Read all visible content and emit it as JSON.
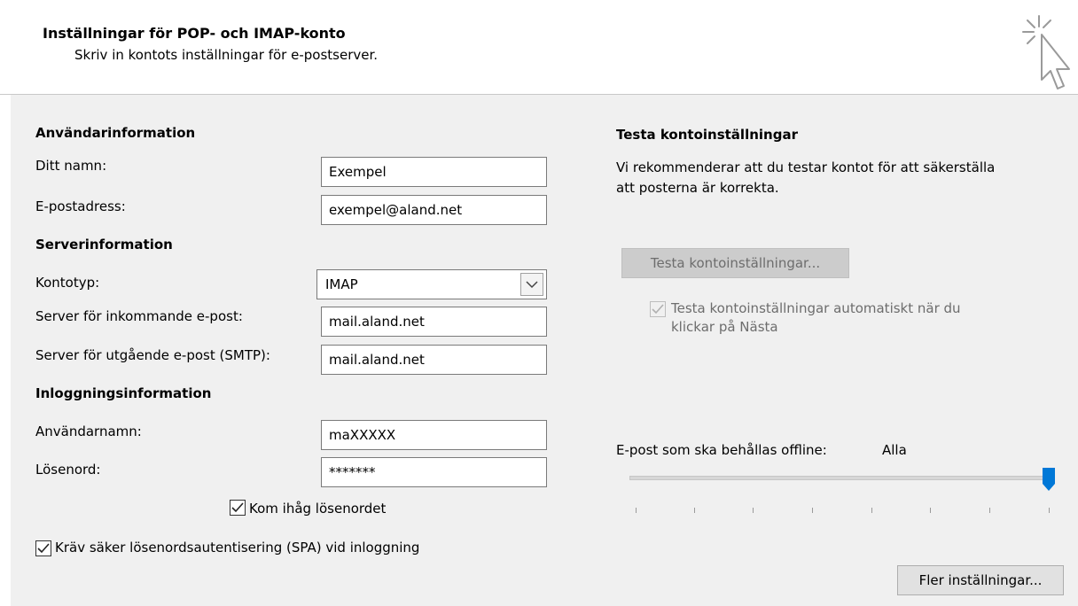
{
  "header": {
    "title": "Inställningar för POP- och IMAP-konto",
    "subtitle": "Skriv in kontots inställningar för e-postserver."
  },
  "user_info": {
    "heading": "Användarinformation",
    "name_label": "Ditt namn:",
    "name_value": "Exempel",
    "email_label": "E-postadress:",
    "email_value": "exempel@aland.net"
  },
  "server_info": {
    "heading": "Serverinformation",
    "account_type_label": "Kontotyp:",
    "account_type_value": "IMAP",
    "incoming_label": "Server för inkommande e-post:",
    "incoming_value": "mail.aland.net",
    "outgoing_label": "Server för utgående e-post (SMTP):",
    "outgoing_value": "mail.aland.net"
  },
  "login_info": {
    "heading": "Inloggningsinformation",
    "username_label": "Användarnamn:",
    "username_value": "maXXXXX",
    "password_label": "Lösenord:",
    "password_value": "*******",
    "remember_label": "Kom ihåg lösenordet",
    "remember_checked": true,
    "spa_label": "Kräv säker lösenordsautentisering (SPA) vid inloggning",
    "spa_checked": true
  },
  "test": {
    "heading": "Testa kontoinställningar",
    "description_line1": "Vi rekommenderar att du testar kontot för att säkerställa",
    "description_line2": "att posterna är korrekta.",
    "button_label": "Testa kontoinställningar...",
    "auto_line1": "Testa kontoinställningar automatiskt när du",
    "auto_line2": "klickar på Nästa",
    "auto_checked": true
  },
  "offline": {
    "label": "E-post som ska behållas offline:",
    "value": "Alla",
    "slider_level": 1.0
  },
  "more_button": "Fler inställningar...",
  "colors": {
    "panel_bg": "#f0f0f0",
    "slider_thumb": "#0078d7",
    "disabled_text": "#6d6d6d"
  },
  "icons": [
    "cursor-click-icon",
    "chevron-down-icon",
    "checkmark-icon"
  ]
}
